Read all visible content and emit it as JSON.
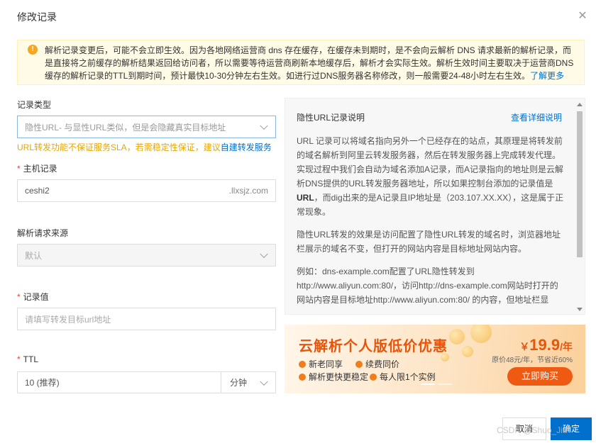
{
  "dialog": {
    "title": "修改记录"
  },
  "notice": {
    "text": "解析记录变更后，可能不会立即生效。因为各地网络运营商 dns 存在缓存，在缓存未到期时，是不会向云解析 DNS 请求最新的解析记录，而是直接将之前缓存的解析结果返回给访问者，所以需要等待运营商刷新本地缓存后，解析才会实际生效。解析生效时间主要取决于运营商DNS缓存的解析记录的TTL到期时间，预计最快10-30分钟左右生效。如进行过DNS服务器名称修改，则一般需要24-48小时左右生效。",
    "link": "了解更多"
  },
  "form": {
    "record_type": {
      "label": "记录类型",
      "value": "隐性URL- 与显性URL类似，但是会隐藏真实目标地址"
    },
    "warning": {
      "text": "URL转发功能不保证服务SLA，若需稳定性保证，建议",
      "link": "自建转发服务"
    },
    "host": {
      "label": "主机记录",
      "value": "ceshi2",
      "suffix": ".llxsjz.com"
    },
    "line": {
      "label": "解析请求来源",
      "value": "默认"
    },
    "record_value": {
      "label": "记录值",
      "placeholder": "请填写转发目标url地址"
    },
    "ttl": {
      "label": "TTL",
      "value": "10 (推荐)",
      "unit": "分钟"
    }
  },
  "help": {
    "title": "隐性URL记录说明",
    "link": "查看详细说明",
    "p1a": "URL 记录可以将域名指向另外一个已经存在的站点，其原理是将转发前的域名解析到阿里云转发服务器，然后在转发服务器上完成转发代理。实现过程中我们会自动为域名添加A记录，而A记录指向的地址则是云解析DNS提供的URL转发服务器地址，所以如果控制台添加的记录值是",
    "p1b": "URL",
    "p1c": "，而dig出来的是A记录且IP地址是（203.107.XX.XX），这是属于正常现象。",
    "p2": "隐性URL转发的效果是访问配置了隐性URL转发的域名时，浏览器地址栏展示的域名不变，但打开的网站内容是目标地址网站内容。",
    "p3": "例如：dns-example.com配置了URL隐性转发到http://www.aliyun.com:80/，访问http://dns-example.com网站时打开的网站内容是目标地址http://www.aliyun.com:80/ 的内容，但地址栏显"
  },
  "promo": {
    "title": "云解析个人版低价优惠",
    "features": [
      "新老同享",
      "续费同价",
      "解析更快更稳定",
      "每人限1个实例"
    ],
    "price_currency": "￥",
    "price": "19.9",
    "price_unit": "/年",
    "original": "原价48元/年，节省近60%",
    "button": "立即购买"
  },
  "footer": {
    "cancel": "取消",
    "ok": "确定",
    "watermark": "CSDN @Shuo_Jiu"
  }
}
